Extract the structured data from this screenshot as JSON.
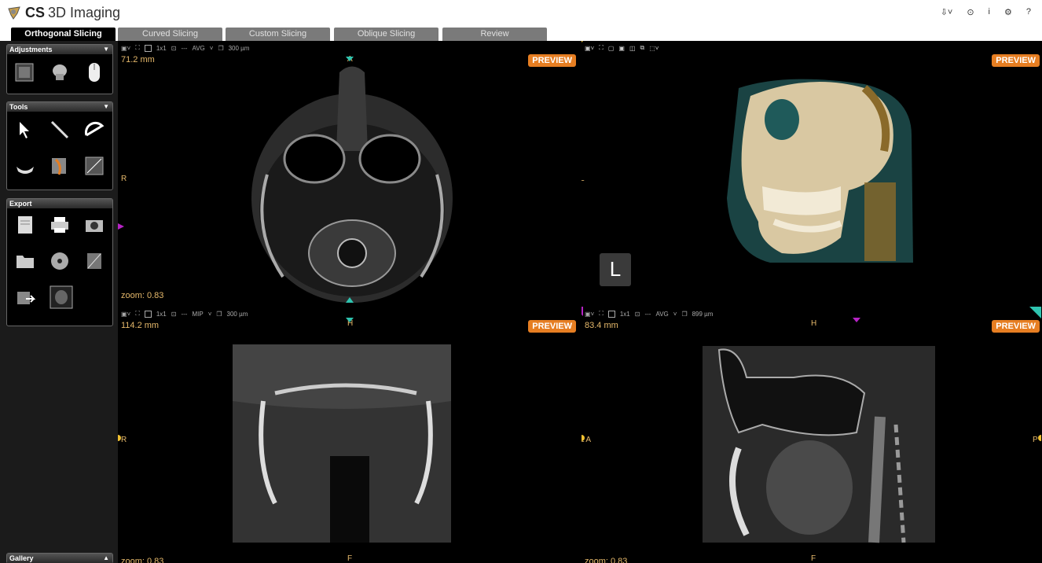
{
  "app": {
    "brand": "CS",
    "name": "3D Imaging"
  },
  "tabs": [
    {
      "label": "Orthogonal Slicing",
      "active": true
    },
    {
      "label": "Curved Slicing"
    },
    {
      "label": "Custom Slicing"
    },
    {
      "label": "Oblique Slicing"
    },
    {
      "label": "Review"
    }
  ],
  "panels": {
    "adjustments": "Adjustments",
    "tools": "Tools",
    "export": "Export",
    "gallery": "Gallery"
  },
  "top_icons": [
    "download-icon",
    "clock-icon",
    "info-icon",
    "settings-icon",
    "help-icon"
  ],
  "viewports": {
    "axial": {
      "layout": "1x1",
      "mode": "AVG",
      "thickness": "300 µm",
      "distance": "71.2 mm",
      "zoom": "zoom: 0.83",
      "top": "A",
      "bottom": "P",
      "left": "R"
    },
    "render3d": {
      "left": "L",
      "marker": "L"
    },
    "coronal": {
      "layout": "1x1",
      "mode": "MIP",
      "thickness": "300 µm",
      "distance": "114.2 mm",
      "zoom": "zoom: 0.83",
      "top": "H",
      "bottom": "F",
      "left": "R"
    },
    "sagittal": {
      "layout": "1x1",
      "mode": "AVG",
      "thickness": "899 µm",
      "distance": "83.4 mm",
      "zoom": "zoom: 0.83",
      "top": "H",
      "bottom": "F",
      "left": "L A",
      "right": "P"
    },
    "preview_label": "PREVIEW"
  },
  "colors": {
    "accent": "#e67e22",
    "label": "#e6b96b",
    "magenta": "#b623c5",
    "cyan": "#2fc4b0",
    "yellow": "#f0c030"
  }
}
